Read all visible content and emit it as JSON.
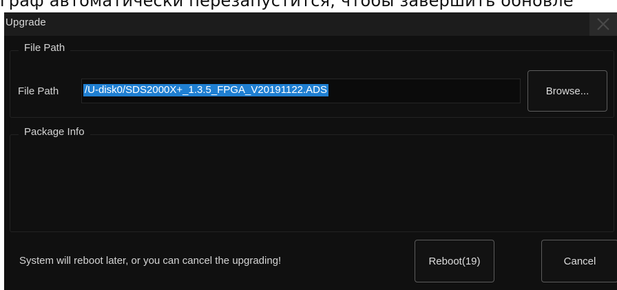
{
  "background": {
    "caption": "граф автоматически перезапустится, чтобы завершить обновле"
  },
  "dialog": {
    "title": "Upgrade",
    "close_icon": "close-icon"
  },
  "file_group": {
    "title": "File Path",
    "field_label": "File Path",
    "field_value": "/U-disk0/SDS2000X+_1.3.5_FPGA_V20191122.ADS",
    "browse_label": "Browse..."
  },
  "package_group": {
    "title": "Package Info"
  },
  "footer": {
    "status": "System will reboot later, or you can cancel the upgrading!",
    "reboot_label": "Reboot(19)",
    "cancel_label": "Cancel"
  },
  "colors": {
    "dialog_bg": "#101010",
    "titlebar_bg": "#1c1c1c",
    "selection": "#1f7fd2",
    "button_border": "#5c5c5c",
    "text": "#d4d4d4"
  }
}
